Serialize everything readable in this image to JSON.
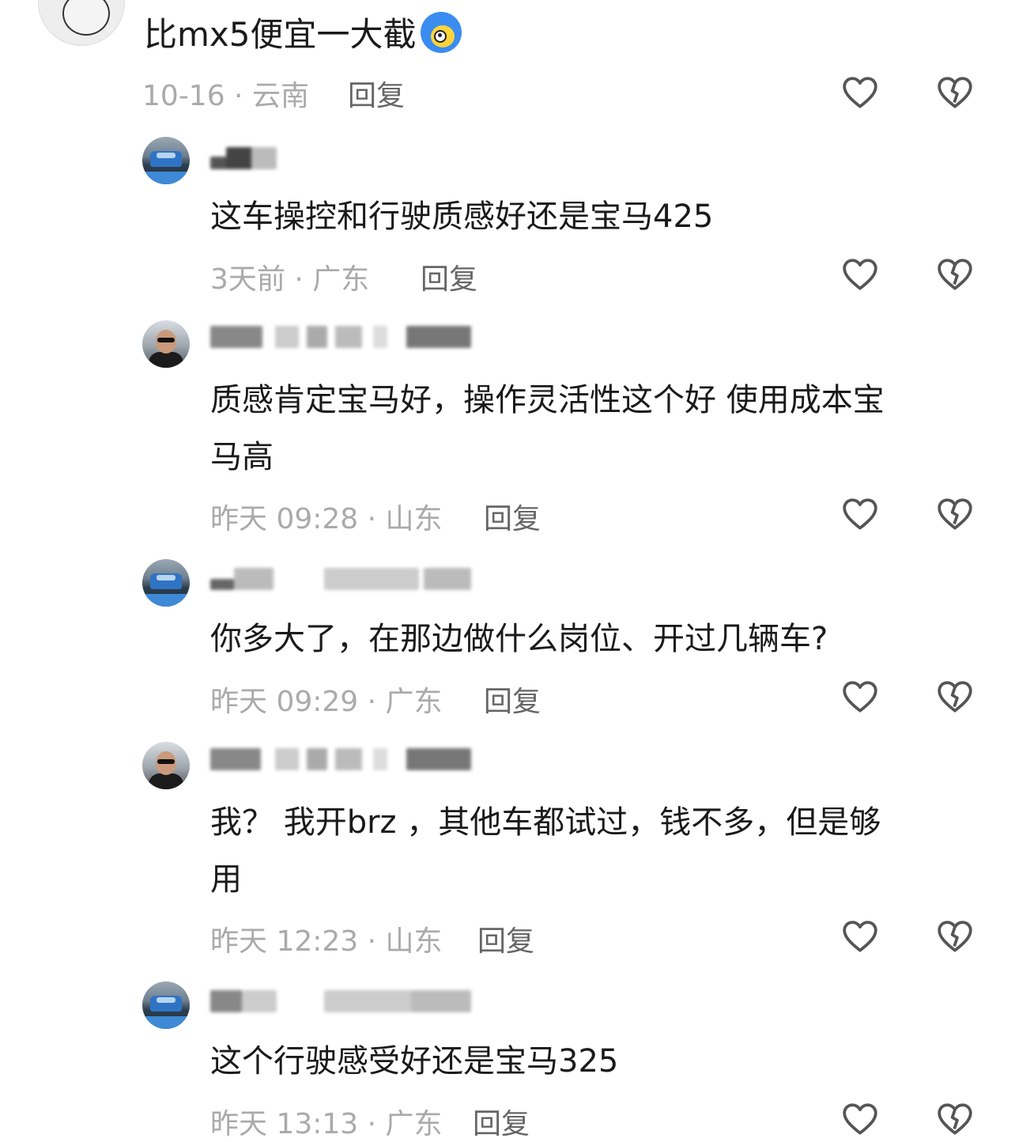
{
  "top_comment": {
    "text": "比mx5便宜一大截",
    "emoji": "blue-face-emoji",
    "meta": "10-16 · 云南",
    "reply_label": "回复"
  },
  "replies": [
    {
      "avatar": "car-avatar",
      "text_lines": [
        "这车操控和行驶质感好还是宝马425"
      ],
      "meta": "3天前 · 广东",
      "reply_label": "回复"
    },
    {
      "avatar": "person-avatar",
      "text_lines": [
        "质感肯定宝马好，操作灵活性这个好 使用成本宝",
        "马高"
      ],
      "meta": "昨天 09:28 · 山东",
      "reply_label": "回复"
    },
    {
      "avatar": "car-avatar",
      "text_lines": [
        "你多大了，在那边做什么岗位、开过几辆车?"
      ],
      "meta": "昨天 09:29 · 广东",
      "reply_label": "回复"
    },
    {
      "avatar": "person-avatar",
      "text_lines": [
        "我？ 我开brz ，其他车都试过，钱不多，但是够",
        "用"
      ],
      "meta": "昨天 12:23 · 山东",
      "reply_label": "回复"
    },
    {
      "avatar": "car-avatar",
      "text_lines": [
        "这个行驶感受好还是宝马325"
      ],
      "meta": "昨天 13:13 · 广东",
      "reply_label": "回复"
    }
  ],
  "icons": {
    "like": "heart-outline-icon",
    "dislike": "broken-heart-icon"
  },
  "colors": {
    "text": "#1a1a1a",
    "meta": "#aaaaaa",
    "reply": "#666666",
    "icon": "#555555",
    "background": "#ffffff"
  }
}
